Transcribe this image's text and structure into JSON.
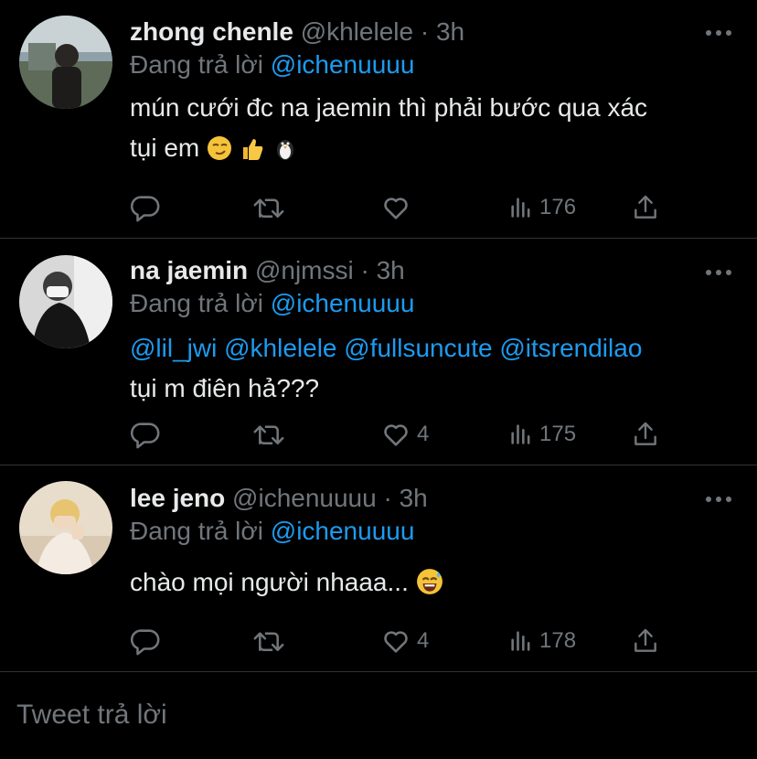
{
  "tweets": [
    {
      "name": "zhong chenle",
      "handle": "@khlelele",
      "dot": "·",
      "time": "3h",
      "reply_prefix": "Đang trả lời",
      "reply_to": "@ichenuuuu",
      "text_line1": "mún cưới đc na jaemin thì phải bước qua xác",
      "text_line2": "tụi em",
      "emojis": [
        "smirk-emoji",
        "thumbs-up-emoji",
        "penguin-emoji"
      ],
      "likes": "",
      "views": "176"
    },
    {
      "name": "na jaemin",
      "handle": "@njmssi",
      "dot": "·",
      "time": "3h",
      "reply_prefix": "Đang trả lời",
      "reply_to": "@ichenuuuu",
      "mentions": [
        "@lil_jwi",
        "@khlelele",
        "@fullsuncute",
        "@itsrendilao"
      ],
      "text_line2": "tụi m điên hả???",
      "likes": "4",
      "views": "175"
    },
    {
      "name": "lee jeno",
      "handle": "@ichenuuuu",
      "dot": "·",
      "time": "3h",
      "reply_prefix": "Đang trả lời",
      "reply_to": "@ichenuuuu",
      "text_line1": "chào mọi người nhaaa...",
      "emojis": [
        "sweat-smile-emoji"
      ],
      "likes": "4",
      "views": "178"
    }
  ],
  "compose": {
    "placeholder": "Tweet trả lời"
  },
  "colors": {
    "background": "#000000",
    "text": "#e7e9ea",
    "muted": "#71767b",
    "accent": "#1d9bf0",
    "divider": "#2f3336"
  },
  "icons": [
    "reply-icon",
    "retweet-icon",
    "like-icon",
    "views-icon",
    "share-icon",
    "more-icon"
  ]
}
